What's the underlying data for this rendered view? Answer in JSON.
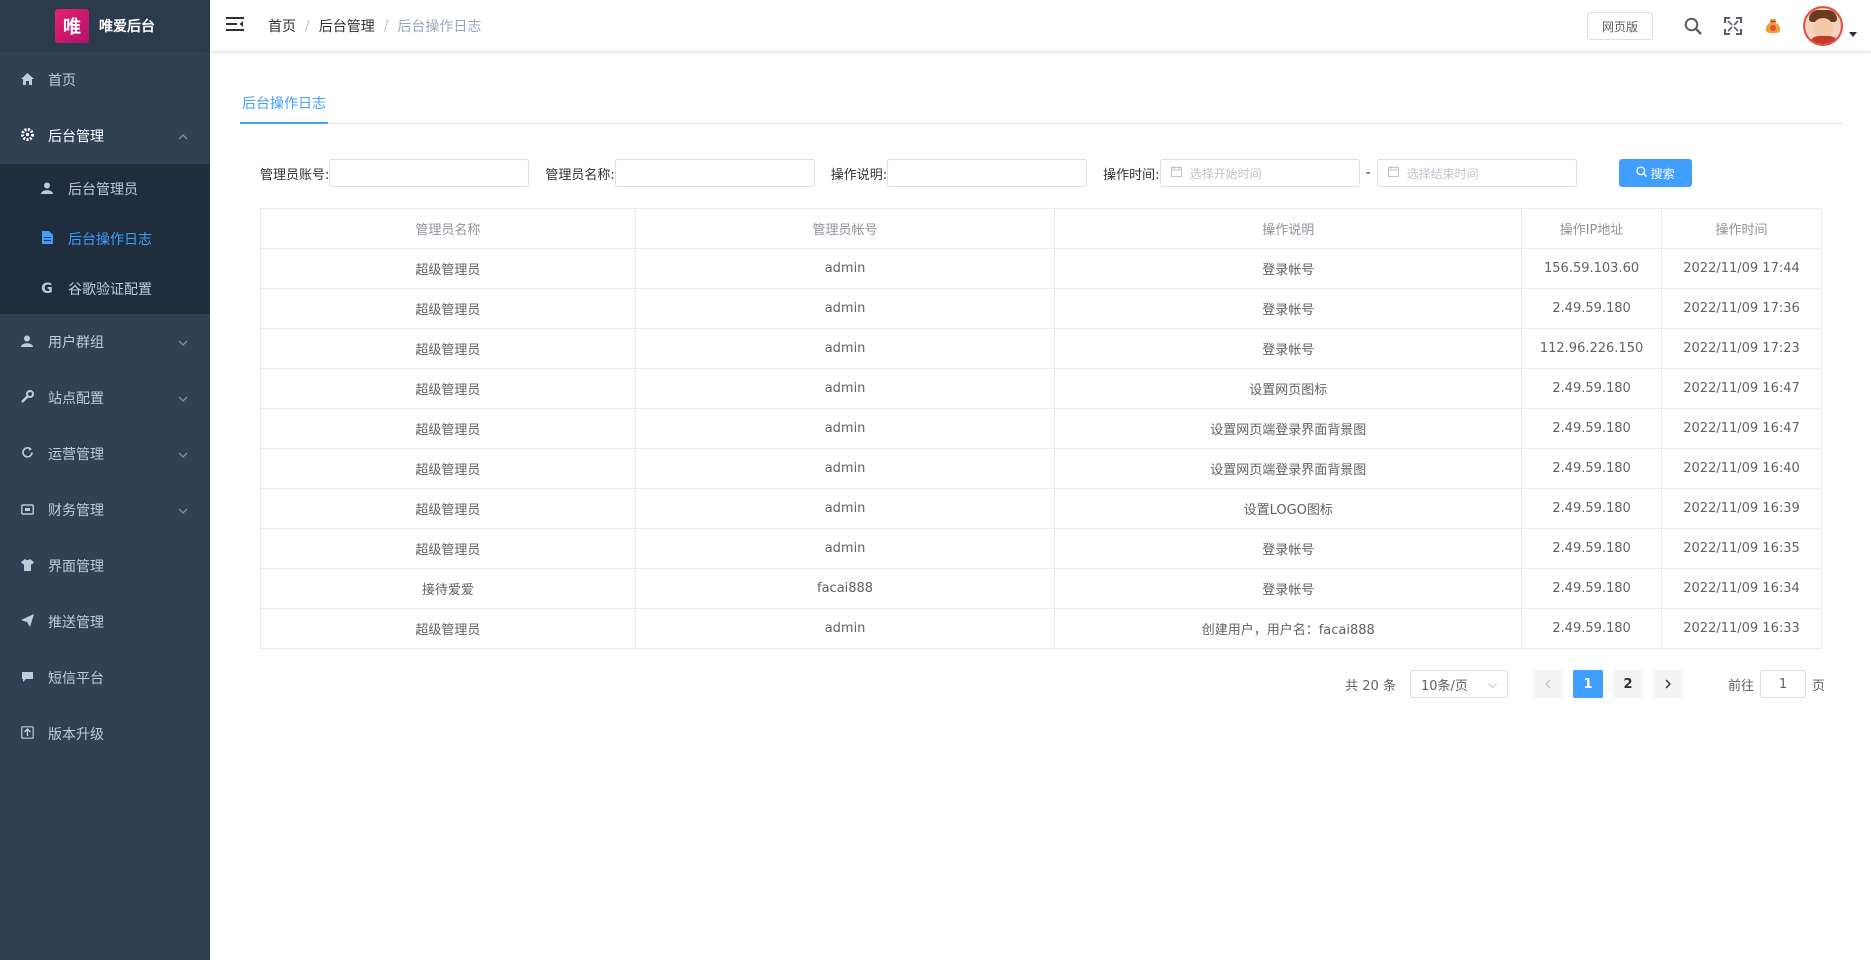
{
  "app": {
    "logo_text": "唯爱后台",
    "logo_badge": "唯"
  },
  "sidebar": {
    "items": [
      {
        "label": "首页",
        "icon": "home-icon"
      },
      {
        "label": "后台管理",
        "icon": "gear-icon",
        "expanded": true
      },
      {
        "label": "用户群组",
        "icon": "user-icon"
      },
      {
        "label": "站点配置",
        "icon": "wrench-icon"
      },
      {
        "label": "运营管理",
        "icon": "refresh-icon"
      },
      {
        "label": "财务管理",
        "icon": "wallet-icon"
      },
      {
        "label": "界面管理",
        "icon": "shirt-icon"
      },
      {
        "label": "推送管理",
        "icon": "send-icon"
      },
      {
        "label": "短信平台",
        "icon": "chat-icon"
      },
      {
        "label": "版本升级",
        "icon": "upgrade-icon"
      }
    ],
    "submenu": [
      {
        "label": "后台管理员",
        "icon": "user-icon"
      },
      {
        "label": "后台操作日志",
        "icon": "document-icon",
        "active": true
      },
      {
        "label": "谷歌验证配置",
        "icon": "google-icon",
        "glyph": "G"
      }
    ]
  },
  "header": {
    "breadcrumb": [
      "首页",
      "后台管理",
      "后台操作日志"
    ],
    "web_button": "网页版"
  },
  "tabs": {
    "active": "后台操作日志"
  },
  "filters": {
    "admin_account_label": "管理员账号:",
    "admin_name_label": "管理员名称:",
    "operation_label": "操作说明:",
    "time_label": "操作时间:",
    "start_placeholder": "选择开始时间",
    "end_placeholder": "选择结束时间",
    "dash": "-",
    "search_label": "搜索"
  },
  "table": {
    "headers": [
      "管理员名称",
      "管理员帐号",
      "操作说明",
      "操作IP地址",
      "操作时间"
    ],
    "rows": [
      [
        "超级管理员",
        "admin",
        "登录帐号",
        "156.59.103.60",
        "2022/11/09 17:44"
      ],
      [
        "超级管理员",
        "admin",
        "登录帐号",
        "2.49.59.180",
        "2022/11/09 17:36"
      ],
      [
        "超级管理员",
        "admin",
        "登录帐号",
        "112.96.226.150",
        "2022/11/09 17:23"
      ],
      [
        "超级管理员",
        "admin",
        "设置网页图标",
        "2.49.59.180",
        "2022/11/09 16:47"
      ],
      [
        "超级管理员",
        "admin",
        "设置网页端登录界面背景图",
        "2.49.59.180",
        "2022/11/09 16:47"
      ],
      [
        "超级管理员",
        "admin",
        "设置网页端登录界面背景图",
        "2.49.59.180",
        "2022/11/09 16:40"
      ],
      [
        "超级管理员",
        "admin",
        "设置LOGO图标",
        "2.49.59.180",
        "2022/11/09 16:39"
      ],
      [
        "超级管理员",
        "admin",
        "登录帐号",
        "2.49.59.180",
        "2022/11/09 16:35"
      ],
      [
        "接待爱爱",
        "facai888",
        "登录帐号",
        "2.49.59.180",
        "2022/11/09 16:34"
      ],
      [
        "超级管理员",
        "admin",
        "创建用户，用户名：facai888",
        "2.49.59.180",
        "2022/11/09 16:33"
      ]
    ]
  },
  "pagination": {
    "total": "共 20 条",
    "page_size": "10条/页",
    "pages": [
      "1",
      "2"
    ],
    "current": "1",
    "goto_label": "前往",
    "goto_value": "1",
    "page_unit": "页"
  },
  "colors": {
    "accent": "#409eff",
    "sidebar_bg": "#304156",
    "submenu_bg": "#1f2d3d"
  }
}
